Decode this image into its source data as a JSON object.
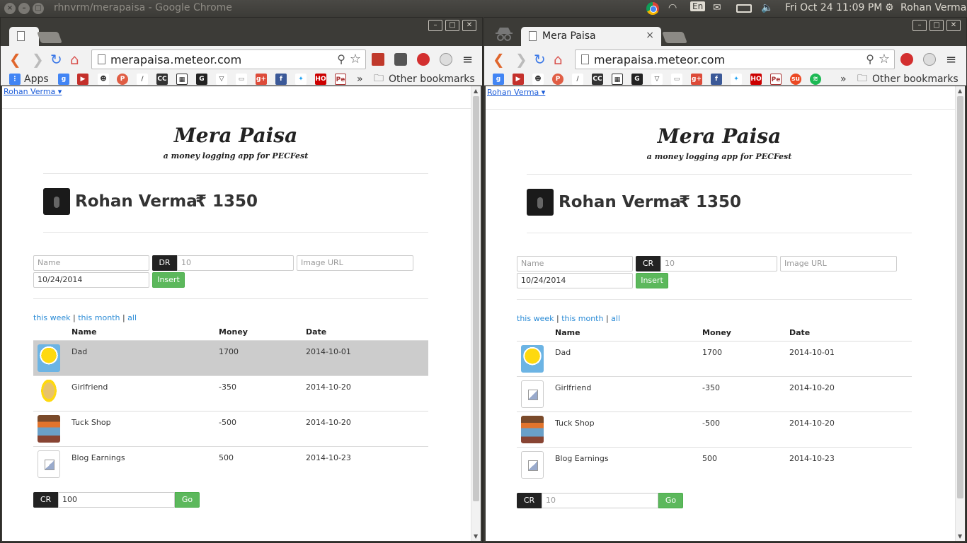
{
  "topbar": {
    "window_title": "rhnvrm/merapaisa - Google Chrome",
    "lang": "En",
    "clock": "Fri Oct 24 11:09 PM",
    "user": "Rohan Verma"
  },
  "left": {
    "tab": {
      "title": ""
    },
    "url": "merapaisa.meteor.com",
    "bookmarks": {
      "apps": "Apps",
      "more": "»",
      "other": "Other bookmarks"
    },
    "user_menu": "Rohan Verma ▾",
    "brand": {
      "title": "Mera Paisa",
      "subtitle": "a money logging app for PECFest"
    },
    "profile": {
      "name": "Rohan Verma",
      "balance": "₹ 1350"
    },
    "form": {
      "name_placeholder": "Name",
      "type_label": "DR",
      "amount_placeholder": "10",
      "image_placeholder": "Image URL",
      "date_value": "10/24/2014",
      "insert_label": "Insert"
    },
    "filters": {
      "week": "this week",
      "sep1": " | ",
      "month": "this month",
      "sep2": " | ",
      "all": "all"
    },
    "table": {
      "headers": {
        "name": "Name",
        "money": "Money",
        "date": "Date"
      },
      "rows": [
        {
          "name": "Dad",
          "money": "1700",
          "date": "2014-10-01"
        },
        {
          "name": "Girlfriend",
          "money": "-350",
          "date": "2014-10-20"
        },
        {
          "name": "Tuck Shop",
          "money": "-500",
          "date": "2014-10-20"
        },
        {
          "name": "Blog Earnings",
          "money": "500",
          "date": "2014-10-23"
        }
      ]
    },
    "quick": {
      "type_label": "CR",
      "amount_value": "100",
      "go_label": "Go"
    }
  },
  "right": {
    "tab": {
      "title": "Mera Paisa",
      "close": "×"
    },
    "url": "merapaisa.meteor.com",
    "bookmarks": {
      "more": "»",
      "other": "Other bookmarks"
    },
    "user_menu": "Rohan Verma ▾",
    "brand": {
      "title": "Mera Paisa",
      "subtitle": "a money logging app for PECFest"
    },
    "profile": {
      "name": "Rohan Verma",
      "balance": "₹ 1350"
    },
    "form": {
      "name_placeholder": "Name",
      "type_label": "CR",
      "amount_placeholder": "10",
      "image_placeholder": "Image URL",
      "date_value": "10/24/2014",
      "insert_label": "Insert"
    },
    "filters": {
      "week": "this week",
      "sep1": " | ",
      "month": "this month",
      "sep2": " | ",
      "all": "all"
    },
    "table": {
      "headers": {
        "name": "Name",
        "money": "Money",
        "date": "Date"
      },
      "rows": [
        {
          "name": "Dad",
          "money": "1700",
          "date": "2014-10-01"
        },
        {
          "name": "Girlfriend",
          "money": "-350",
          "date": "2014-10-20"
        },
        {
          "name": "Tuck Shop",
          "money": "-500",
          "date": "2014-10-20"
        },
        {
          "name": "Blog Earnings",
          "money": "500",
          "date": "2014-10-23"
        }
      ]
    },
    "quick": {
      "type_label": "CR",
      "amount_placeholder": "10",
      "go_label": "Go"
    }
  }
}
